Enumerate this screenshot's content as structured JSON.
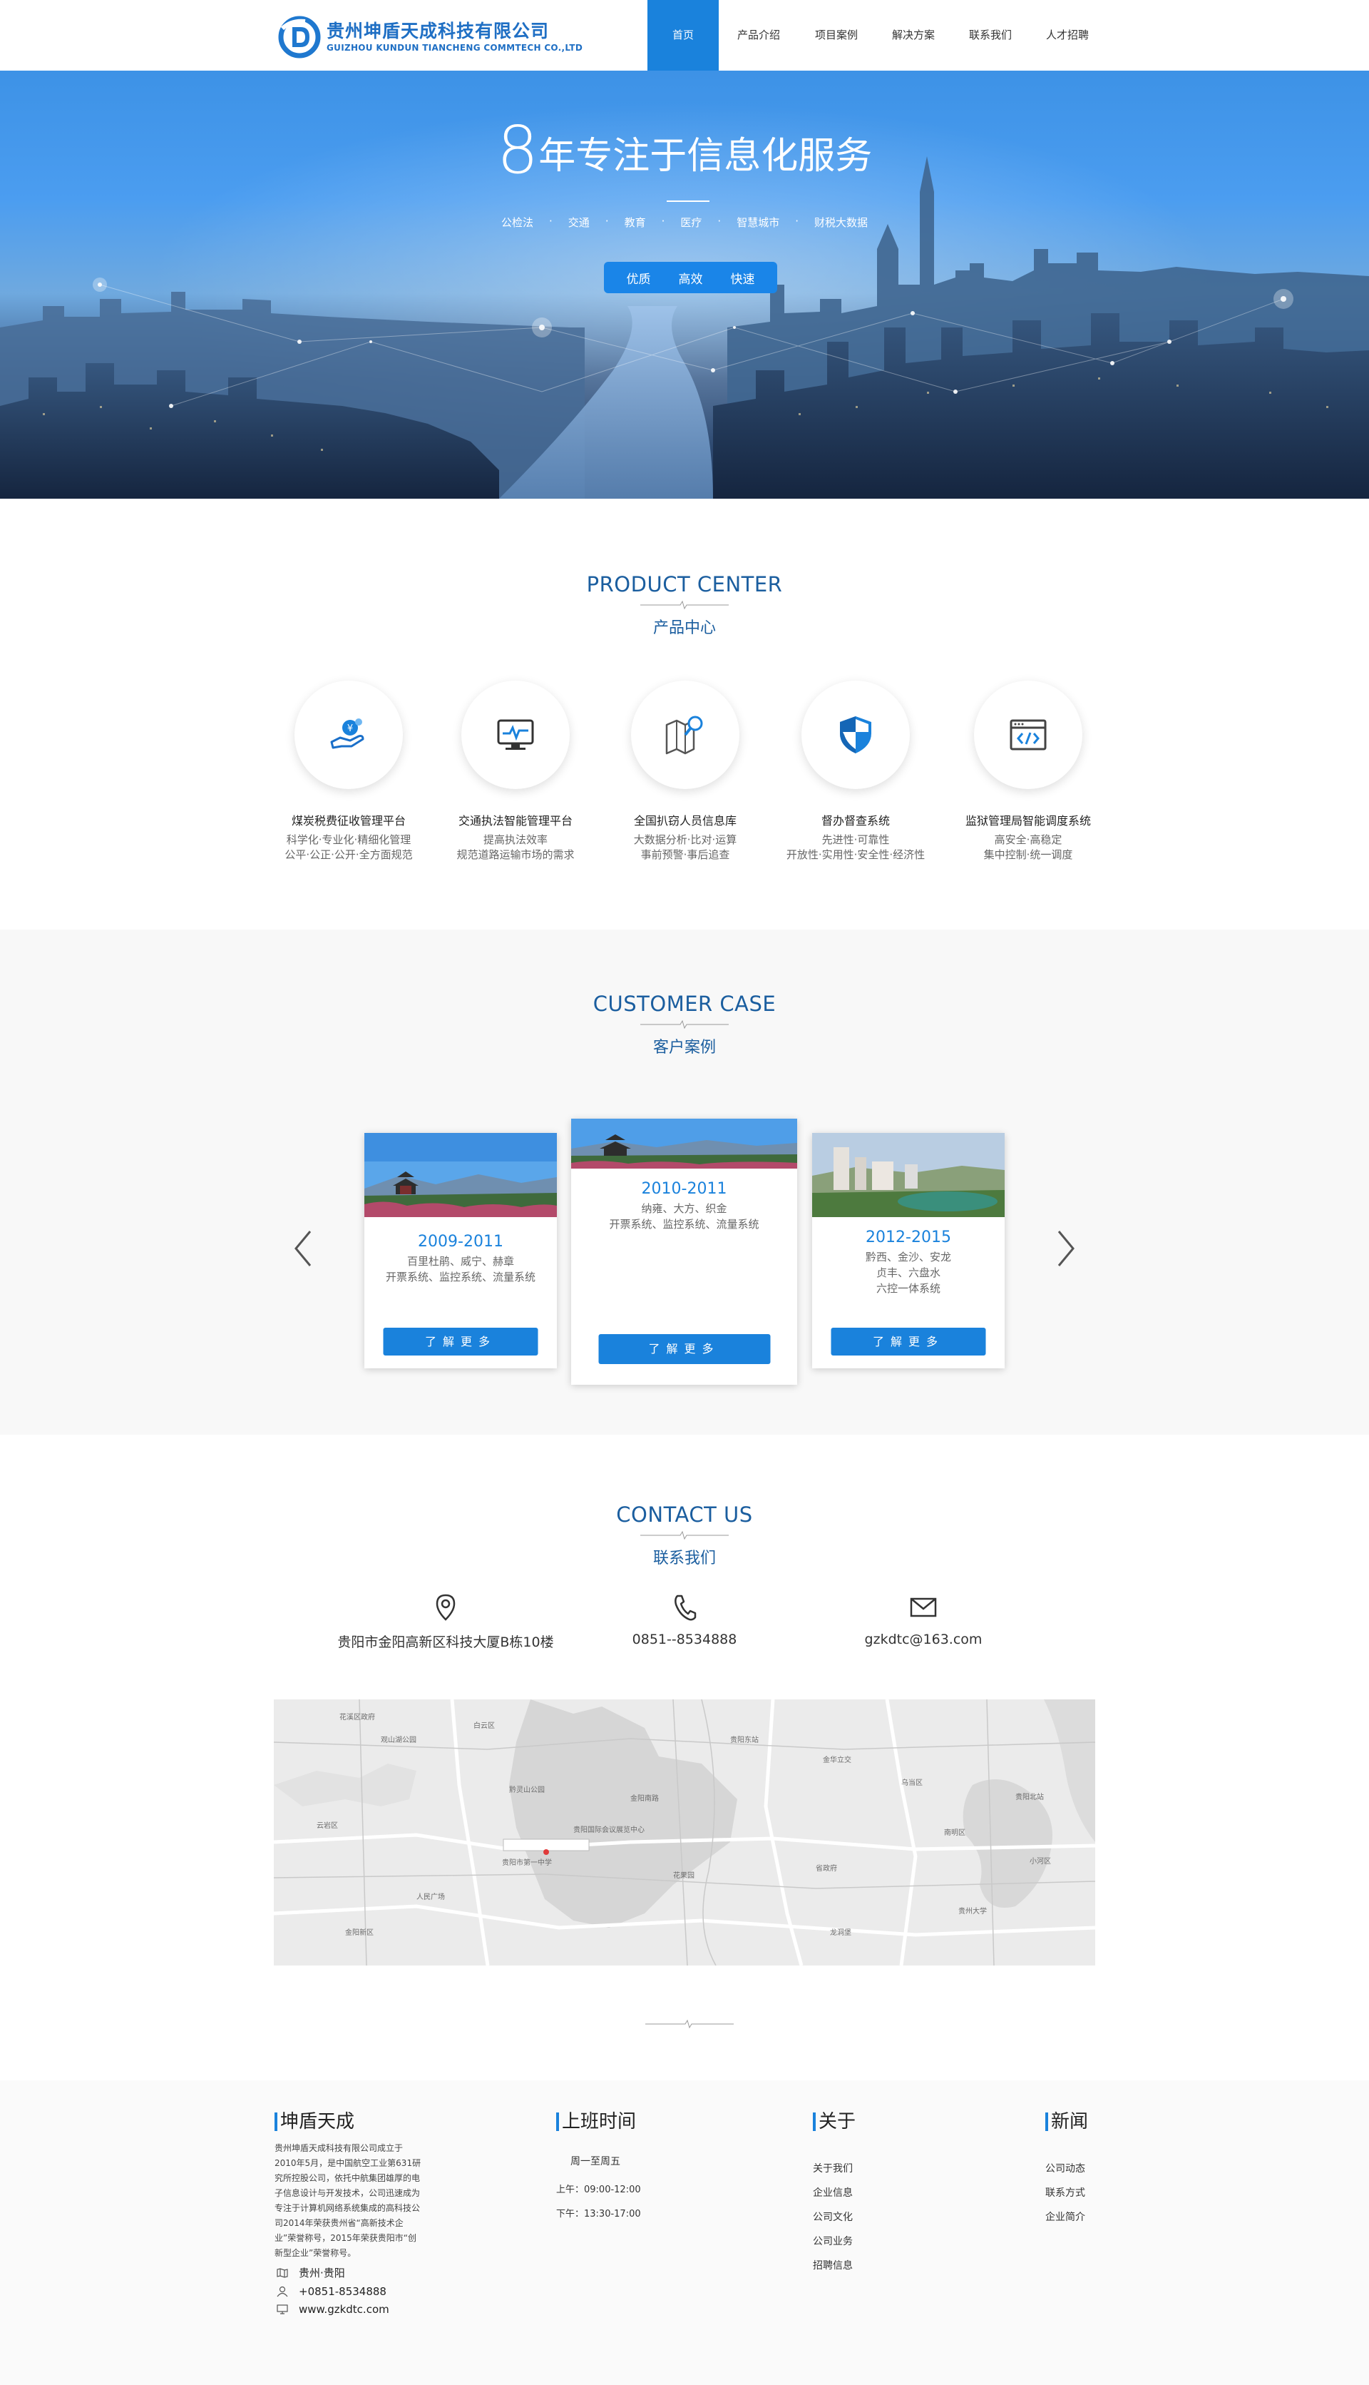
{
  "header": {
    "company_cn": "贵州坤盾天成科技有限公司",
    "company_en": "GUIZHOU KUNDUN TIANCHENG COMMTECH CO.,LTD",
    "nav": [
      "首页",
      "产品介绍",
      "项目案例",
      "解决方案",
      "联系我们",
      "人才招聘"
    ],
    "active_nav": "首页"
  },
  "banner": {
    "title_num": "8",
    "title_text": "年专注于信息化服务",
    "tags": [
      "公检法",
      "交通",
      "教育",
      "医疗",
      "智慧城市",
      "财税大数据"
    ],
    "pill": [
      "优质",
      "高效",
      "快速"
    ]
  },
  "products": {
    "title_en": "PRODUCT CENTER",
    "title_cn": "产品中心",
    "items": [
      {
        "icon": "tax-coins-icon",
        "title": "煤炭税费征收管理平台",
        "desc1": "科学化·专业化·精细化管理",
        "desc2": "公平·公正·公开·全方面规范"
      },
      {
        "icon": "monitor-pulse-icon",
        "title": "交通执法智能管理平台",
        "desc1": "提高执法效率",
        "desc2": "规范道路运输市场的需求"
      },
      {
        "icon": "map-search-icon",
        "title": "全国扒窃人员信息库",
        "desc1": "大数据分析·比对·运算",
        "desc2": "事前预警·事后追查"
      },
      {
        "icon": "shield-icon",
        "title": "督办督查系统",
        "desc1": "先进性·可靠性",
        "desc2": "开放性·实用性·安全性·经济性"
      },
      {
        "icon": "code-window-icon",
        "title": "监狱管理局智能调度系统",
        "desc1": "高安全·高稳定",
        "desc2": "集中控制·统一调度"
      }
    ]
  },
  "cases": {
    "title_en": "CUSTOMER CASE",
    "title_cn": "客户案例",
    "button_label": "了解更多",
    "items": [
      {
        "year": "2009-2011",
        "lines": [
          "百里杜鹃、威宁、赫章",
          "开票系统、监控系统、流量系统"
        ]
      },
      {
        "year": "2010-2011",
        "lines": [
          "纳雍、大方、织金",
          "开票系统、监控系统、流量系统"
        ]
      },
      {
        "year": "2012-2015",
        "lines": [
          "黔西、金沙、安龙",
          "贞丰、六盘水",
          "六控一体系统"
        ]
      }
    ]
  },
  "contact": {
    "title_en": "CONTACT US",
    "title_cn": "联系我们",
    "address": "贵阳市金阳高新区科技大厦B栋10楼",
    "phone": "0851--8534888",
    "email": "gzkdtc@163.com",
    "map_labels": [
      "花溪区政府",
      "贵阳市第一中学",
      "贵阳国际会议展览中心",
      "金阳南路",
      "黔灵山公园",
      "观山湖公园",
      "金华立交",
      "贵阳东站",
      "花果园",
      "白云区",
      "乌当区",
      "南明区",
      "云岩区",
      "贵阳北站",
      "省政府",
      "人民广场",
      "小河区",
      "龙洞堡",
      "金阳新区",
      "贵州大学"
    ]
  },
  "footer": {
    "about_title": "坤盾天成",
    "about_text": "贵州坤盾天成科技有限公司成立于2010年5月，是中国航空工业第631研究所控股公司，依托中航集团雄厚的电子信息设计与开发技术，公司迅速成为专注于计算机网络系统集成的高科技公司2014年荣获贵州省“高新技术企业”荣誉称号，2015年荣获贵阳市“创新型企业”荣誉称号。",
    "location": "贵州·贵阳",
    "phone": "+0851-8534888",
    "website": "www.gzkdtc.com",
    "hours_title": "上班时间",
    "hours": [
      "周一至周五",
      "上午：09:00-12:00",
      "下午：13:30-17:00"
    ],
    "about_col_title": "关于",
    "about_links": [
      "关于我们",
      "企业信息",
      "公司文化",
      "公司业务",
      "招聘信息"
    ],
    "news_title": "新闻",
    "news_links": [
      "公司动态",
      "联系方式",
      "企业简介"
    ]
  },
  "colors": {
    "accent": "#1a82dc",
    "heading": "#1b5e9f"
  }
}
